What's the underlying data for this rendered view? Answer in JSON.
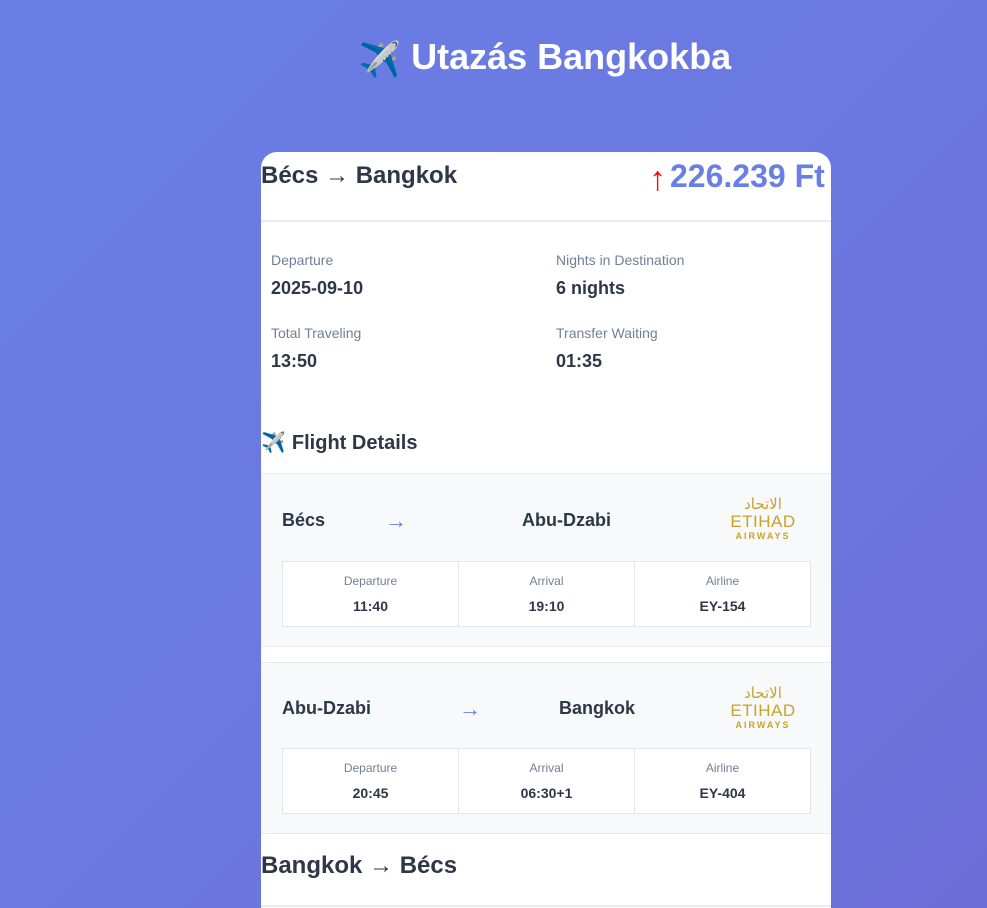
{
  "page": {
    "title": "Utazás Bangkokba",
    "title_icon": "airplane-icon"
  },
  "outbound": {
    "route": "Bécs → Bangkok",
    "price_arrow": "↑",
    "price": "226.239 Ft",
    "info": [
      {
        "label": "Departure",
        "value": "2025-09-10"
      },
      {
        "label": "Nights in Destination",
        "value": "6 nights"
      },
      {
        "label": "Total Traveling",
        "value": "13:50"
      },
      {
        "label": "Transfer Waiting",
        "value": "01:35"
      }
    ],
    "section_title": "Flight Details",
    "segments": [
      {
        "from": "Bécs",
        "arrow": "→",
        "to": "Abu-Dzabi",
        "airline_logo": "etihad-airways-logo",
        "logo_text_main": "ETIHAD",
        "logo_text_sub": "AIRWAYS",
        "logo_arabic": "الاتحاد",
        "details": [
          {
            "label": "Departure",
            "value": "11:40"
          },
          {
            "label": "Arrival",
            "value": "19:10"
          },
          {
            "label": "Airline",
            "value": "EY-154"
          }
        ]
      },
      {
        "from": "Abu-Dzabi",
        "arrow": "→",
        "to": "Bangkok",
        "airline_logo": "etihad-airways-logo",
        "logo_text_main": "ETIHAD",
        "logo_text_sub": "AIRWAYS",
        "logo_arabic": "الاتحاد",
        "details": [
          {
            "label": "Departure",
            "value": "20:45"
          },
          {
            "label": "Arrival",
            "value": "06:30+1"
          },
          {
            "label": "Airline",
            "value": "EY-404"
          }
        ]
      }
    ]
  },
  "return_trip": {
    "route": "Bangkok → Bécs"
  },
  "colors": {
    "accent": "#6a7fe6",
    "price_up": "#ee1111",
    "logo_gold": "#c9a227",
    "text_dark": "#2d3748",
    "text_muted": "#718096"
  }
}
